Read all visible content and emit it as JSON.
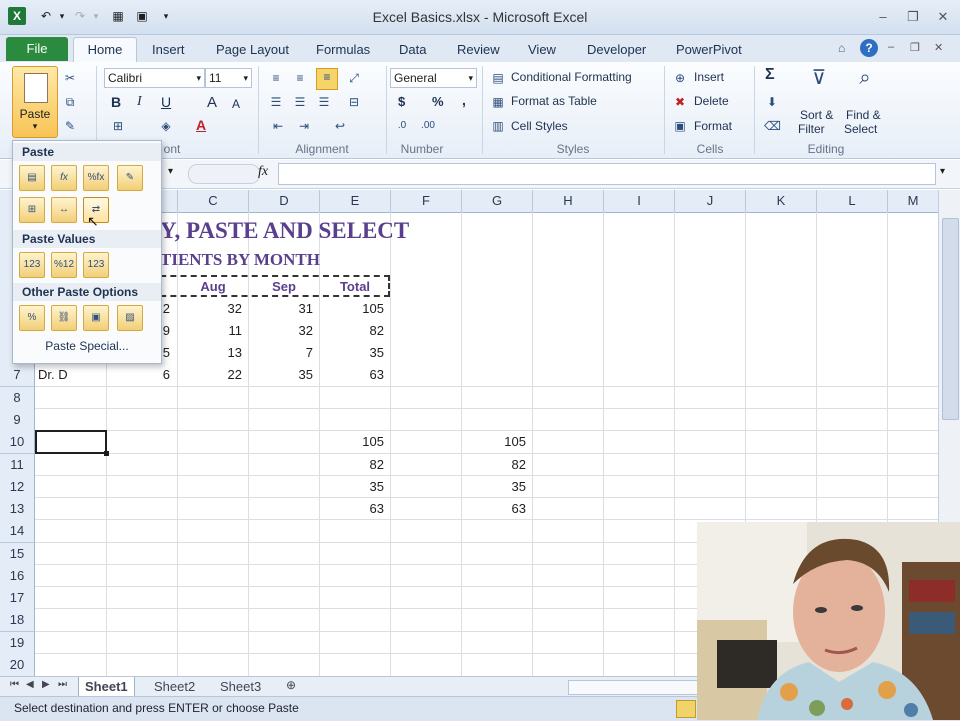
{
  "window": {
    "title": "Excel Basics.xlsx - Microsoft Excel",
    "app_logo": "X"
  },
  "tabs": [
    "File",
    "Home",
    "Insert",
    "Page Layout",
    "Formulas",
    "Data",
    "Review",
    "View",
    "Developer",
    "PowerPivot"
  ],
  "ribbon": {
    "clipboard": {
      "paste_label": "Paste",
      "group_label": "ont"
    },
    "font": {
      "name": "Calibri",
      "size": "11",
      "bold": "B",
      "italic": "I",
      "underline": "U",
      "grow": "A",
      "shrink": "A",
      "font_color": "A"
    },
    "alignment": {
      "group_label": "Alignment"
    },
    "number": {
      "format": "General",
      "currency": "$",
      "percent": "%",
      "comma": ",",
      "group_label": "Number"
    },
    "styles": {
      "conditional": "Conditional Formatting",
      "as_table": "Format as Table",
      "cell_styles": "Cell Styles",
      "group_label": "Styles"
    },
    "cells": {
      "insert": "Insert",
      "delete": "Delete",
      "format": "Format",
      "group_label": "Cells"
    },
    "editing": {
      "sum": "Σ",
      "sort_filter_1": "Sort &",
      "sort_filter_2": "Filter",
      "find_select_1": "Find &",
      "find_select_2": "Select",
      "group_label": "Editing"
    }
  },
  "formula_bar": {
    "fx": "fx",
    "content": ""
  },
  "columns": [
    "C",
    "D",
    "E",
    "F",
    "G",
    "H",
    "I",
    "J",
    "K",
    "L",
    "M"
  ],
  "rows": [
    "7",
    "8",
    "9",
    "10",
    "11",
    "12",
    "13",
    "14",
    "15",
    "16",
    "17",
    "18",
    "19",
    "20"
  ],
  "sheet": {
    "title_fragment": "Y, PASTE AND SELECT",
    "subtitle_fragment": "TIENTS BY MONTH",
    "header": {
      "aug": "Aug",
      "sep": "Sep",
      "total": "Total"
    },
    "data_rows": [
      {
        "b": "2",
        "c": "32",
        "d": "31",
        "e": "105"
      },
      {
        "b": "9",
        "c": "11",
        "d": "32",
        "e": "82"
      },
      {
        "b": "5",
        "c": "13",
        "d": "7",
        "e": "35"
      },
      {
        "a": "Dr. D",
        "b": "6",
        "c": "22",
        "d": "35",
        "e": "63"
      }
    ],
    "pasted_e": [
      "105",
      "82",
      "35",
      "63"
    ],
    "pasted_g": [
      "105",
      "82",
      "35",
      "63"
    ]
  },
  "paste_menu": {
    "paste_header": "Paste",
    "values_header": "Paste Values",
    "other_header": "Other Paste Options",
    "special": "Paste Special..."
  },
  "sheet_tabs": [
    "Sheet1",
    "Sheet2",
    "Sheet3"
  ],
  "status": {
    "message": "Select destination and press ENTER or choose Paste"
  },
  "colors": {
    "accent_green": "#2a8a3e",
    "title_purple": "#5a3f8e",
    "selection_border": "#1e1e1e"
  }
}
